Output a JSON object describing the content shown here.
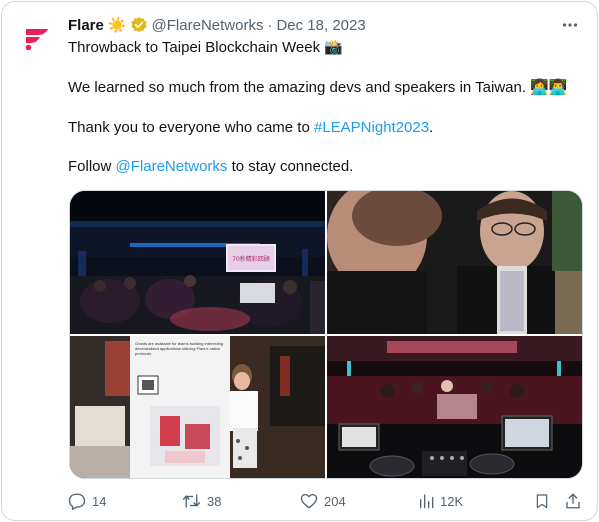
{
  "author": {
    "name": "Flare",
    "handle": "@FlareNetworks",
    "separator": "·",
    "date": "Dec 18, 2023",
    "name_emoji": "☀️"
  },
  "text": {
    "line1": "Throwback to Taipei Blockchain Week 📸",
    "line2": "We learned so much from the amazing devs and speakers in Taiwan. 👩‍💻👨‍💻",
    "line3_pre": "Thank you to everyone who came to ",
    "line3_link": "#LEAPNight2023",
    "line3_post": ".",
    "line4_pre": "Follow ",
    "line4_link": "@FlareNetworks",
    "line4_post": " to stay connected."
  },
  "media": {
    "photo1": {
      "screen_text": "70秒精彩回顾",
      "desc_icon": "photo"
    },
    "photo3": {
      "banner_text": "Grants are available for teams building interesting decentralized applications utilizing Flare's native protocols"
    }
  },
  "actions": {
    "replies": "14",
    "reposts": "38",
    "likes": "204",
    "views": "12K"
  },
  "colors": {
    "brand": "#e62058",
    "link": "#1d9bf0",
    "muted": "#536471",
    "verified": "#e2b719"
  }
}
